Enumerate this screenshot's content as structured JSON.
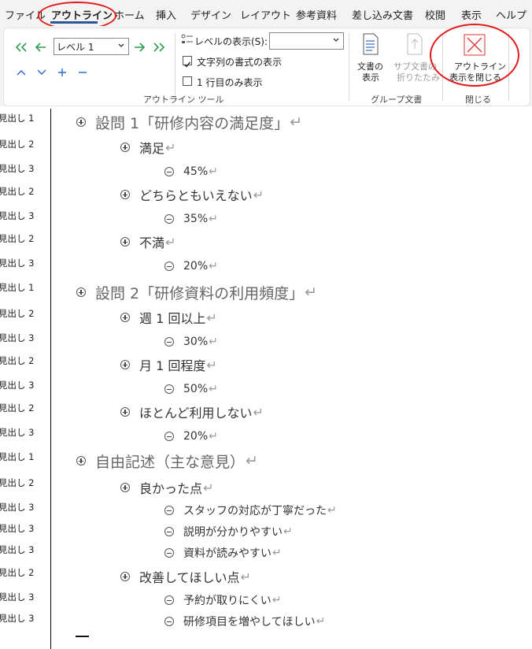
{
  "tabs": [
    "ファイル",
    "アウトライン",
    "ホーム",
    "挿入",
    "デザイン",
    "レイアウト",
    "参考資料",
    "差し込み文書",
    "校閲",
    "表示",
    "ヘルプ"
  ],
  "active_tab": "アウトライン",
  "ribbon": {
    "level_select": "レベル 1",
    "show_level_label": "レベルの表示(S):",
    "show_level_value": "",
    "show_formatting_label": "文字列の書式の表示",
    "show_formatting_checked": true,
    "first_line_only_label": "1 行目のみ表示",
    "first_line_only_checked": false,
    "outline_tools_label": "アウトライン ツール",
    "show_document": [
      "文書の",
      "表示"
    ],
    "collapse_subdocs": [
      "サブ文書の",
      "折りたたみ"
    ],
    "master_document_label": "グループ文書",
    "close_outline": [
      "アウトライン",
      "表示を閉じる"
    ],
    "close_label": "閉じる"
  },
  "style_labels": [
    "見出し 1",
    "見出し 2",
    "見出し 3",
    "見出し 2",
    "見出し 3",
    "見出し 2",
    "見出し 3",
    "見出し 1",
    "見出し 2",
    "見出し 3",
    "見出し 2",
    "見出し 3",
    "見出し 2",
    "見出し 3",
    "見出し 1",
    "見出し 2",
    "見出し 3",
    "見出し 3",
    "見出し 3",
    "見出し 2",
    "見出し 3",
    "見出し 3"
  ],
  "outline": [
    {
      "level": 1,
      "text": "設問 1「研修内容の満足度」",
      "expand": "plus"
    },
    {
      "level": 2,
      "text": "満足",
      "expand": "plus"
    },
    {
      "level": 3,
      "text": "45%",
      "expand": "minus"
    },
    {
      "level": 2,
      "text": "どちらともいえない",
      "expand": "plus"
    },
    {
      "level": 3,
      "text": "35%",
      "expand": "minus"
    },
    {
      "level": 2,
      "text": "不満",
      "expand": "plus"
    },
    {
      "level": 3,
      "text": "20%",
      "expand": "minus"
    },
    {
      "level": 1,
      "text": "設問 2「研修資料の利用頻度」",
      "expand": "plus"
    },
    {
      "level": 2,
      "text": "週 1 回以上",
      "expand": "plus"
    },
    {
      "level": 3,
      "text": "30%",
      "expand": "minus"
    },
    {
      "level": 2,
      "text": "月 1 回程度",
      "expand": "plus"
    },
    {
      "level": 3,
      "text": "50%",
      "expand": "minus"
    },
    {
      "level": 2,
      "text": "ほとんど利用しない",
      "expand": "plus"
    },
    {
      "level": 3,
      "text": "20%",
      "expand": "minus"
    },
    {
      "level": 1,
      "text": "自由記述（主な意見）",
      "expand": "plus"
    },
    {
      "level": 2,
      "text": "良かった点",
      "expand": "plus"
    },
    {
      "level": 3,
      "text": "スタッフの対応が丁寧だった",
      "expand": "minus"
    },
    {
      "level": 3,
      "text": "説明が分かりやすい",
      "expand": "minus"
    },
    {
      "level": 3,
      "text": "資料が読みやすい",
      "expand": "minus"
    },
    {
      "level": 2,
      "text": "改善してほしい点",
      "expand": "plus"
    },
    {
      "level": 3,
      "text": "予約が取りにくい",
      "expand": "minus"
    },
    {
      "level": 3,
      "text": "研修項目を増やしてほしい",
      "expand": "minus"
    }
  ],
  "paragraph_mark": "↵",
  "colors": {
    "accent": "#2b579a",
    "arrow_green": "#2e9c4f",
    "nav_blue": "#2f6fd1",
    "highlight_red": "#e01a1a"
  }
}
